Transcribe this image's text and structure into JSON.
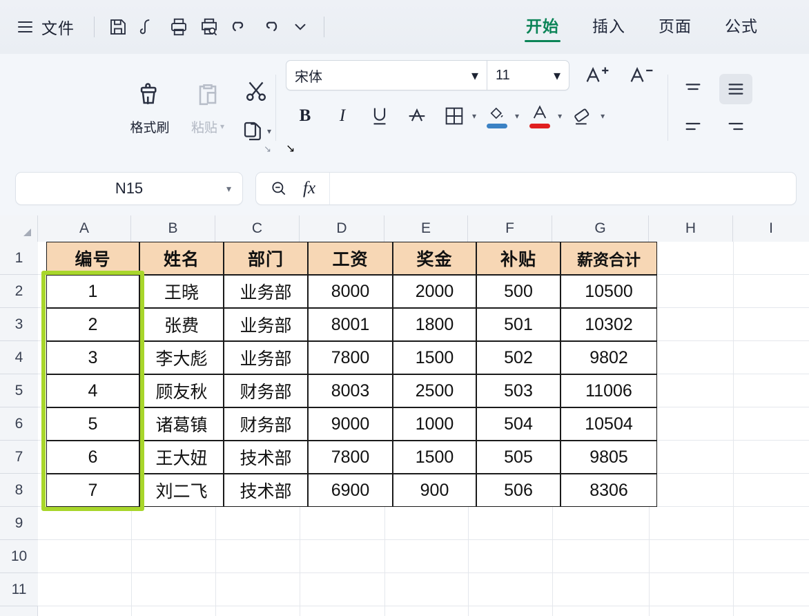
{
  "menubar": {
    "hamburger_icon": "hamburger-menu-icon",
    "file_label": "文件",
    "quick_access": [
      {
        "name": "save-icon",
        "title": "保存"
      },
      {
        "name": "cloud-save-icon",
        "title": "云保存"
      },
      {
        "name": "print-icon",
        "title": "打印"
      },
      {
        "name": "print-preview-icon",
        "title": "打印预览"
      },
      {
        "name": "undo-icon",
        "title": "撤销"
      },
      {
        "name": "redo-icon",
        "title": "恢复"
      },
      {
        "name": "chevron-down-icon",
        "title": "更多"
      }
    ],
    "tabs": [
      {
        "label": "开始",
        "active": true
      },
      {
        "label": "插入",
        "active": false
      },
      {
        "label": "页面",
        "active": false
      },
      {
        "label": "公式",
        "active": false
      }
    ],
    "active_tab_color": "#0b8457"
  },
  "ribbon": {
    "clipboard": {
      "format_painter_label": "格式刷",
      "paste_label": "粘贴",
      "paste_disabled": true,
      "cut_name": "scissors-cut-icon",
      "copy_name": "copy-icon"
    },
    "font": {
      "font_name": "宋体",
      "font_size": "11",
      "increase_size_label": "A",
      "decrease_size_label": "A",
      "bold_label": "B",
      "italic_label": "I",
      "underline_label": "U",
      "strikethrough_label": "A",
      "fill_color": "#3b82c4",
      "font_color": "#e01f1f"
    },
    "align": {
      "top_align": "top-align-icon",
      "middle_align": "middle-align-icon",
      "bottom_left_align": "align-left-icon",
      "bottom_right_align": "align-right-icon",
      "active": "middle-align-icon"
    }
  },
  "formula_bar": {
    "name_box_value": "N15",
    "search_icon": "search-zoom-icon",
    "fx_label": "fx",
    "formula_value": ""
  },
  "sheet": {
    "columns": [
      "A",
      "B",
      "C",
      "D",
      "E",
      "F",
      "G",
      "H",
      "I"
    ],
    "rows": [
      "1",
      "2",
      "3",
      "4",
      "5",
      "6",
      "7",
      "8",
      "9",
      "10",
      "11"
    ],
    "header_fill": "#f7d7b5",
    "highlight_color": "#a8d62b",
    "highlight_range": "A2:A8",
    "table": {
      "headers": [
        "编号",
        "姓名",
        "部门",
        "工资",
        "奖金",
        "补贴",
        "薪资合计"
      ],
      "rows": [
        [
          "1",
          "王晓",
          "业务部",
          "8000",
          "2000",
          "500",
          "10500"
        ],
        [
          "2",
          "张费",
          "业务部",
          "8001",
          "1800",
          "501",
          "10302"
        ],
        [
          "3",
          "李大彪",
          "业务部",
          "7800",
          "1500",
          "502",
          "9802"
        ],
        [
          "4",
          "顾友秋",
          "财务部",
          "8003",
          "2500",
          "503",
          "11006"
        ],
        [
          "5",
          "诸葛镇",
          "财务部",
          "9000",
          "1000",
          "504",
          "10504"
        ],
        [
          "6",
          "王大妞",
          "技术部",
          "7800",
          "1500",
          "505",
          "9805"
        ],
        [
          "7",
          "刘二飞",
          "技术部",
          "6900",
          "900",
          "506",
          "8306"
        ]
      ]
    }
  }
}
